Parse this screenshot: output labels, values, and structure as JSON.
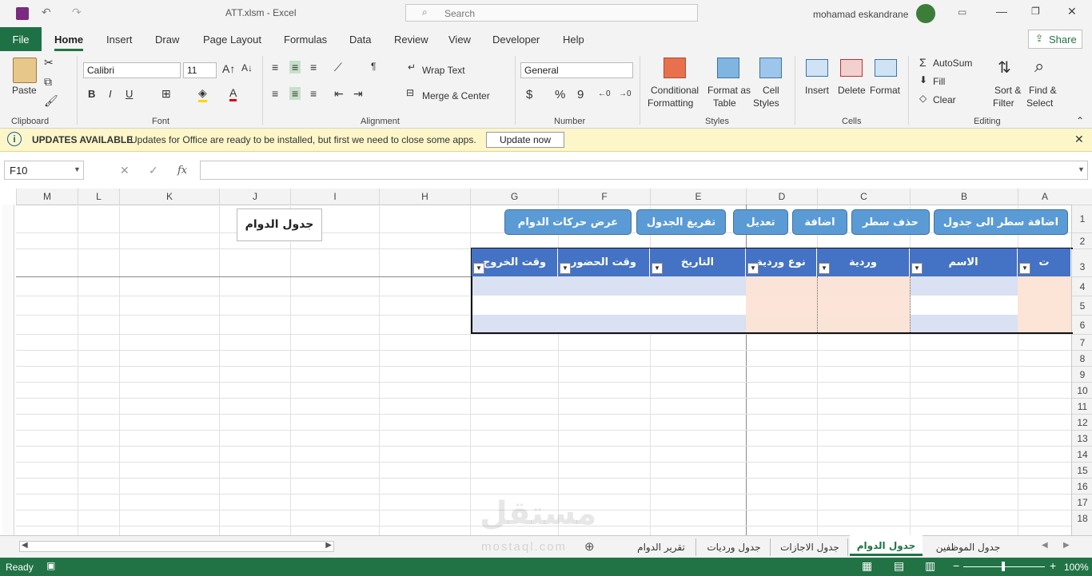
{
  "titlebar": {
    "filename": "ATT.xlsm",
    "separator": "-",
    "app": "Excel",
    "search_placeholder": "Search",
    "user": "mohamad eskandrane"
  },
  "menu": {
    "tabs": [
      "File",
      "Home",
      "Insert",
      "Draw",
      "Page Layout",
      "Formulas",
      "Data",
      "Review",
      "View",
      "Developer",
      "Help"
    ],
    "share": "Share"
  },
  "ribbon": {
    "clipboard": {
      "paste": "Paste",
      "group": "Clipboard"
    },
    "font": {
      "name": "Calibri",
      "size": "11",
      "bold": "B",
      "italic": "I",
      "underline": "U",
      "group": "Font"
    },
    "alignment": {
      "wrap": "Wrap Text",
      "merge": "Merge & Center",
      "group": "Alignment"
    },
    "number": {
      "format": "General",
      "currency": "$",
      "percent": "%",
      "comma": "9",
      "group": "Number"
    },
    "styles": {
      "conditional": "Conditional",
      "formatting": "Formatting",
      "format_as": "Format as",
      "table": "Table",
      "cell": "Cell",
      "styles_lbl": "Styles",
      "group": "Styles"
    },
    "cells": {
      "insert": "Insert",
      "delete": "Delete",
      "format": "Format",
      "group": "Cells"
    },
    "editing": {
      "autosum": "AutoSum",
      "fill": "Fill",
      "clear": "Clear",
      "sort": "Sort &",
      "filter": "Filter",
      "find": "Find &",
      "select": "Select",
      "group": "Editing"
    }
  },
  "updates": {
    "title": "UPDATES AVAILABLE",
    "message": "Updates for Office are ready to be installed, but first we need to close some apps.",
    "button": "Update now"
  },
  "formula": {
    "namebox": "F10",
    "fx": "fx"
  },
  "columns": [
    "M",
    "L",
    "K",
    "J",
    "I",
    "H",
    "G",
    "F",
    "E",
    "D",
    "C",
    "B",
    "A"
  ],
  "rows": [
    "1",
    "2",
    "3",
    "4",
    "5",
    "6",
    "7",
    "8",
    "9",
    "10",
    "11",
    "12",
    "13",
    "14",
    "15",
    "16",
    "17",
    "18"
  ],
  "sheet": {
    "title": "جدول الدوام",
    "buttons": [
      "اضافة سطر الى جدول",
      "حذف سطر",
      "اضافة",
      "تعديل",
      "تفريغ الجدول",
      "عرض حركات الدوام"
    ],
    "headers": [
      "ت",
      "الاسم",
      "وردية",
      "نوع وردية",
      "التاريخ",
      "وقت الحضور",
      "وقت الخروج"
    ]
  },
  "sheet_tabs": [
    "جدول الموظفين",
    "جدول الدوام",
    "جدول الاجازات",
    "جدول ورديات",
    "تقرير الدوام"
  ],
  "status": {
    "ready": "Ready",
    "zoom": "100%"
  },
  "watermark": {
    "ar": "مستقل",
    "en": "mostaql.com"
  }
}
